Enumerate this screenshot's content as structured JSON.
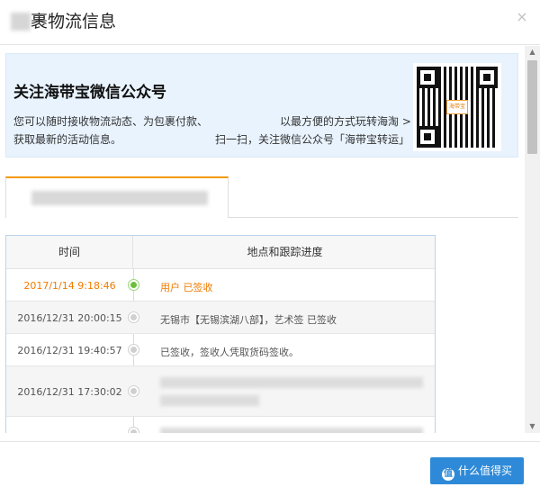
{
  "dialog": {
    "title": "裹物流信息",
    "close_glyph": "×"
  },
  "promo": {
    "title": "关注海带宝微信公众号",
    "line1_left": "您可以随时接收物流动态、为包裹付款、",
    "line1_right": "以最方便的方式玩转海淘 >",
    "line2_left": "获取最新的活动信息。",
    "line2_right": "扫一扫，关注微信公众号「海带宝转运」",
    "qr_logo_text": "海带宝"
  },
  "table": {
    "col_time": "时间",
    "col_location": "地点和跟踪进度",
    "rows": [
      {
        "time": "2017/1/14 9:18:46",
        "desc": "用户 已签收",
        "current": true
      },
      {
        "time": "2016/12/31 20:00:15",
        "desc": "无锡市【无锡滨湖八部】，艺术签 已签收",
        "current": false
      },
      {
        "time": "2016/12/31 19:40:57",
        "desc": "已签收，签收人凭取货码签收。",
        "current": false
      },
      {
        "time": "2016/12/31 17:30:02",
        "desc": "",
        "current": false
      },
      {
        "time": "",
        "desc": "",
        "current": false
      }
    ]
  },
  "footer": {
    "watermark_text": "什么值得买",
    "watermark_icon": "值"
  },
  "colors": {
    "accent": "#f07b00",
    "current_dot": "#6cbf3c",
    "promo_bg": "#e8f3fe",
    "table_border": "#bcd4ec"
  }
}
